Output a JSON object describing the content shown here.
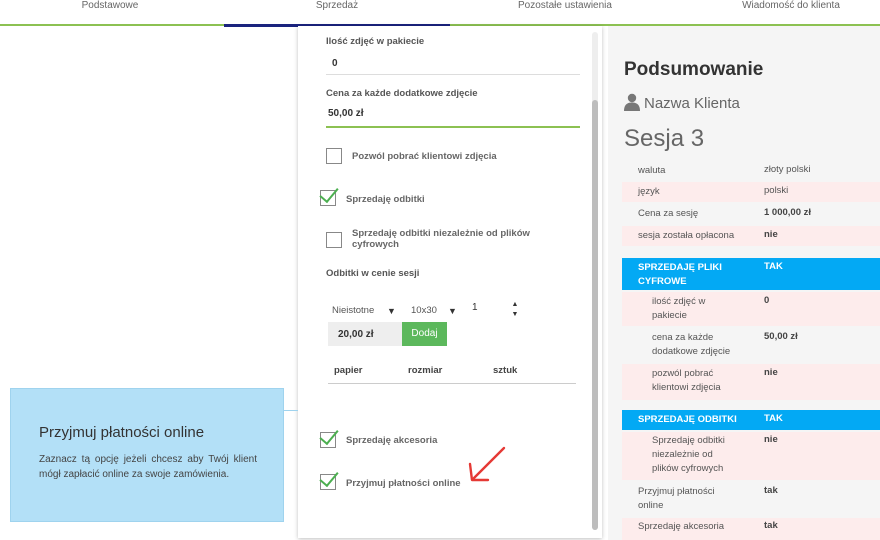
{
  "tabs": [
    {
      "label": "Podstawowe"
    },
    {
      "label": "Sprzedaż"
    },
    {
      "label": "Pozostałe ustawienia"
    },
    {
      "label": "Wiadomość do klienta"
    }
  ],
  "form": {
    "photos_in_package_label": "Ilość zdjęć w pakiecie",
    "photos_in_package_value": "0",
    "extra_photo_price_label": "Cena za każde dodatkowe zdjęcie",
    "extra_photo_price_value": "50,00 zł",
    "allow_download_label": "Pozwól pobrać klientowi zdjęcia",
    "allow_download_checked": false,
    "sell_prints_label": "Sprzedaję odbitki",
    "sell_prints_checked": true,
    "sell_prints_independent_label": "Sprzedaję odbitki niezależnie od plików cyfrowych",
    "sell_prints_independent_checked": false,
    "prints_in_session_label": "Odbitki w cenie sesji",
    "paper_select": "Nieistotne",
    "size_select": "10x30",
    "quantity": "1",
    "price": "20,00 zł",
    "add_button": "Dodaj",
    "table_headers": [
      "papier",
      "rozmiar",
      "sztuk"
    ],
    "sell_accessories_label": "Sprzedaję akcesoria",
    "sell_accessories_checked": true,
    "accept_online_label": "Przyjmuj płatności online",
    "accept_online_checked": true
  },
  "tooltip": {
    "title": "Przyjmuj płatności online",
    "text": "Zaznacz tą opcję jeżeli chcesz aby Twój klient mógł zapłacić online za swoje zamówienia."
  },
  "summary": {
    "title": "Podsumowanie",
    "client": "Nazwa Klienta",
    "session": "Sesja 3",
    "rows": [
      {
        "key": "waluta",
        "value": "złoty polski"
      },
      {
        "key": "język",
        "value": "polski"
      },
      {
        "key": "Cena za sesję",
        "value": "1 000,00 zł"
      },
      {
        "key": "sesja została opłacona",
        "value": "nie"
      },
      {
        "key": "SPRZEDAJĘ PLIKI CYFROWE",
        "value": "tak"
      },
      {
        "key": "ilość zdjęć w pakiecie",
        "value": "0"
      },
      {
        "key": "cena za każde dodatkowe zdjęcie",
        "value": "50,00 zł"
      },
      {
        "key": "pozwól pobrać klientowi zdjęcia",
        "value": "nie"
      },
      {
        "key": "SPRZEDAJĘ ODBITKI",
        "value": "tak"
      },
      {
        "key": "Sprzedaję odbitki niezależnie od plików cyfrowych",
        "value": "nie"
      },
      {
        "key": "Przyjmuj płatności online",
        "value": "tak"
      },
      {
        "key": "Sprzedaję akcesoria",
        "value": "tak"
      }
    ]
  },
  "colors": {
    "accent_green": "#8cc152",
    "active_tab": "#1a237e",
    "highlight_blue": "#03a9f4",
    "tooltip_bg": "#b3e0f7",
    "check_green": "#4caf50",
    "arrow_red": "#e53935"
  }
}
